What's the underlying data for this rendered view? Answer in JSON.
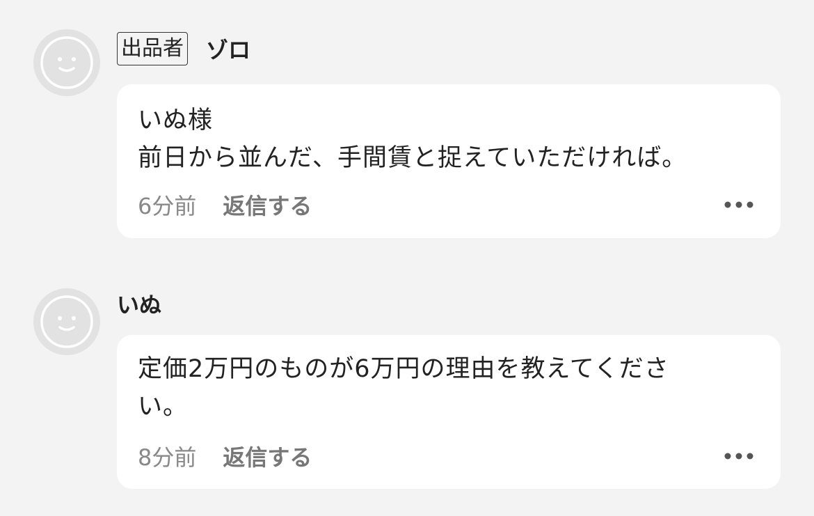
{
  "comments": [
    {
      "seller_badge": "出品者",
      "author": "ゾロ",
      "body_lines": [
        "いぬ様",
        "前日から並んだ、手間賃と捉えていただければ。"
      ],
      "time": "6分前",
      "reply_label": "返信する"
    },
    {
      "seller_badge": "",
      "author": "いぬ",
      "body_lines": [
        "定価2万円のものが6万円の理由を教えてくださ",
        "い。"
      ],
      "time": "8分前",
      "reply_label": "返信する"
    }
  ],
  "icons": {
    "avatar": "smiley-face-icon",
    "more": "more-horizontal-icon"
  },
  "colors": {
    "background": "#f3f3f3",
    "bubble": "#ffffff",
    "avatar": "#e2e2e2",
    "meta_text": "#888888"
  }
}
